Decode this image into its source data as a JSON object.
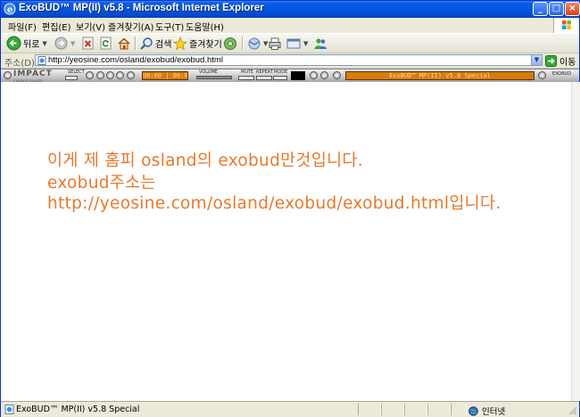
{
  "window": {
    "title": "ExoBUD™ MP(II) v5.8 - Microsoft Internet Explorer",
    "controls": {
      "minimize": "_",
      "maximize": "□",
      "close": "×"
    }
  },
  "menubar": {
    "items": [
      {
        "label": "파일(F)"
      },
      {
        "label": "편집(E)"
      },
      {
        "label": "보기(V)"
      },
      {
        "label": "즐겨찾기(A)"
      },
      {
        "label": "도구(T)"
      },
      {
        "label": "도움말(H)"
      }
    ]
  },
  "toolbar": {
    "back_label": "뒤로",
    "search_label": "검색",
    "favorites_label": "즐겨찾기"
  },
  "address": {
    "label": "주소(D)",
    "url": "http://yeosine.com/osland/exobud/exobud.html",
    "go_label": "이동"
  },
  "player": {
    "logo": "IMPACT",
    "logo_sub": "EXOBUD PLAYER",
    "label_select": "SELECT",
    "label_volume": "VOLUME",
    "label_mute": "MUTE",
    "label_repeat": "REPEAT",
    "label_mode": "MODE",
    "label_exobud": "EXOBUD",
    "time_display": "00:00 | 00:00",
    "title_display": "ExoBUD™ MP(II) v5.8 Special"
  },
  "content": {
    "lines": [
      "이게 제 홈피 osland의 exobud만것입니다.",
      "exobud주소는",
      "http://yeosine.com/osland/exobud/exobud.html입니다."
    ],
    "text_color": "#e8792e"
  },
  "statusbar": {
    "status_text": "ExoBUD™ MP(II) v5.8 Special",
    "zone_label": "인터넷"
  },
  "colors": {
    "titlebar": "#0554e0",
    "chrome": "#ece9d8",
    "player_display": "#d87c0a"
  }
}
